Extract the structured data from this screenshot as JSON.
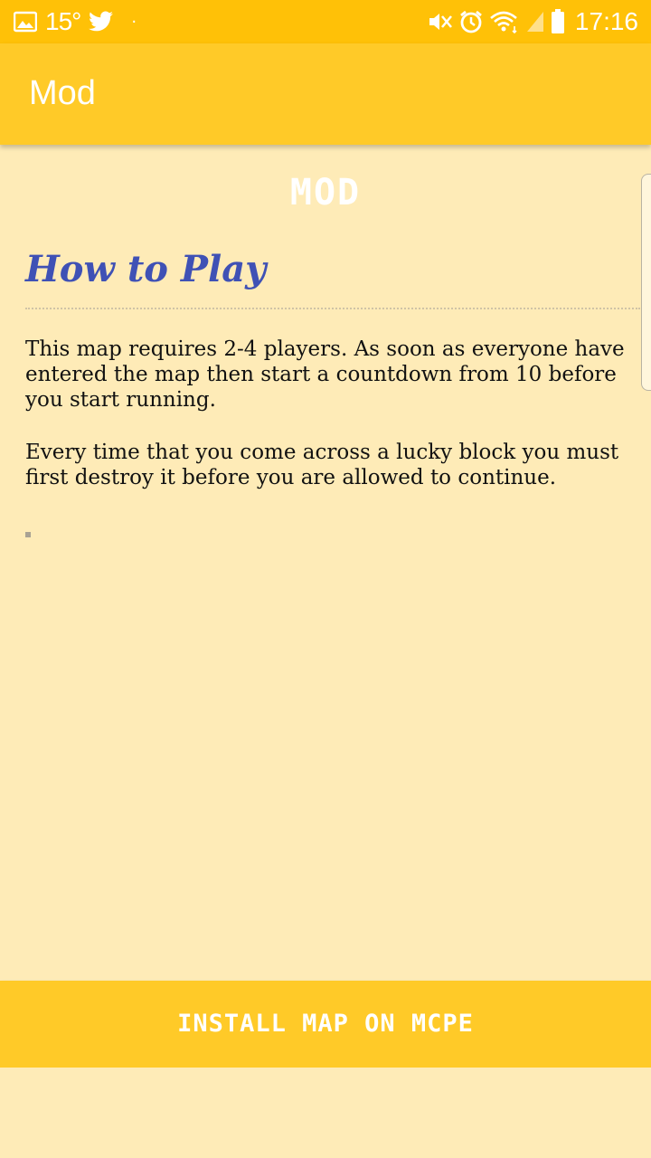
{
  "status_bar": {
    "temperature": "15°",
    "dot": "·",
    "time": "17:16",
    "icons": [
      "image-icon",
      "twitter-icon",
      "mute-icon",
      "alarm-icon",
      "wifi-icon",
      "signal-icon",
      "battery-icon"
    ]
  },
  "app_bar": {
    "title": "Mod"
  },
  "content": {
    "pixel_title": "MOD",
    "heading": "How to Play",
    "paragraphs": [
      "This map requires 2-4 players. As soon as everyone have entered the map then start a countdown from 10 before you start running.",
      "Every time that you come across a lucky block you must first destroy it before you are allowed to continue."
    ]
  },
  "install_button": {
    "label": "INSTALL MAP ON MCPE"
  },
  "colors": {
    "status_bar": "#ffc107",
    "app_bar": "#ffca28",
    "background": "#feebb7",
    "heading": "#3f51b5"
  }
}
